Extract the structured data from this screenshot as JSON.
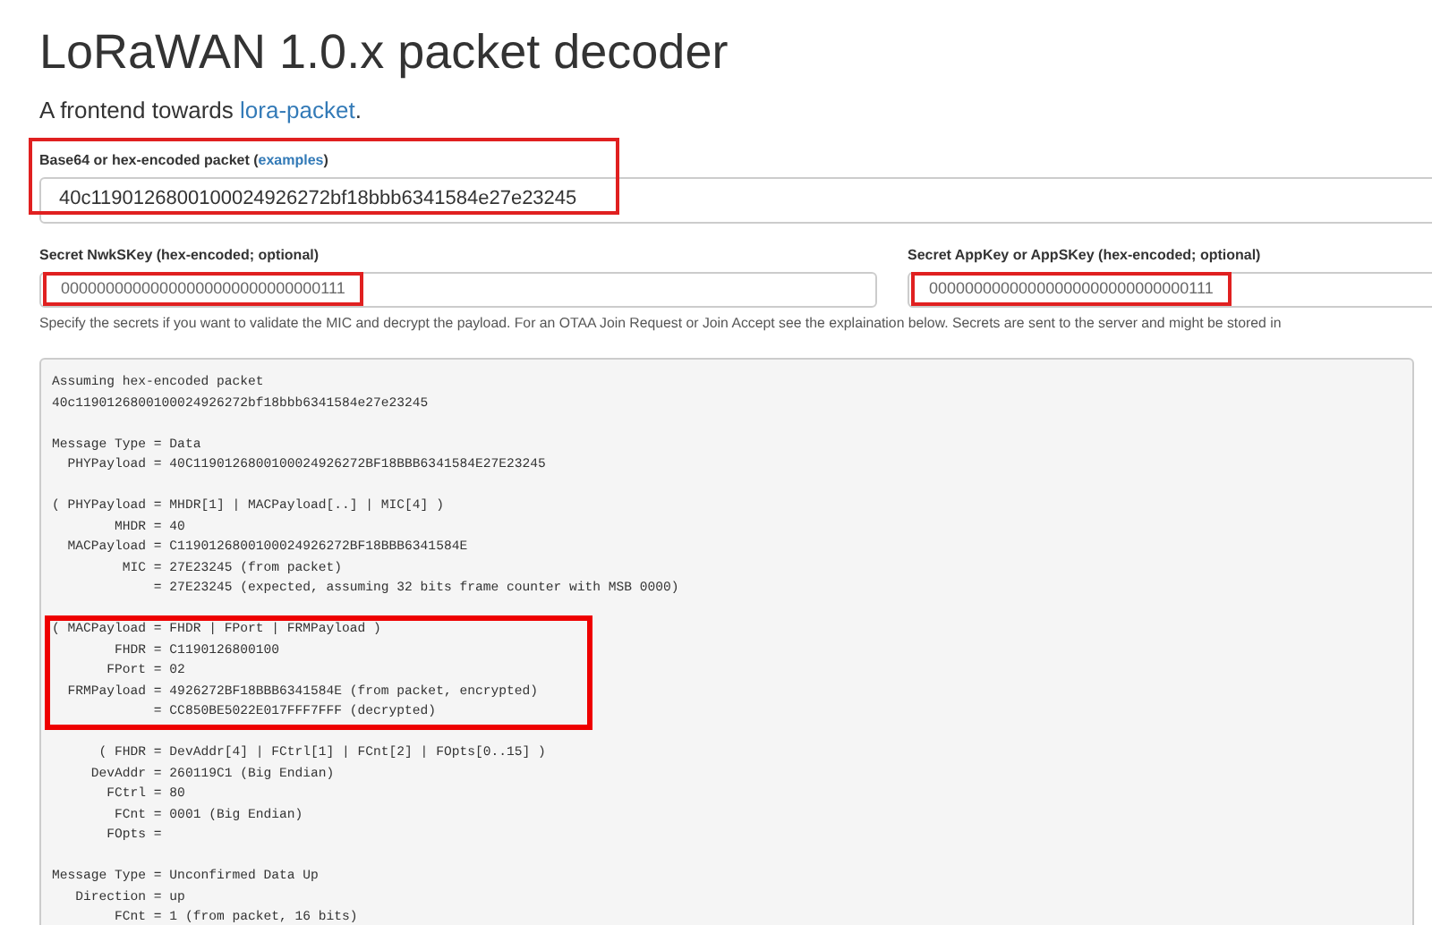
{
  "header": {
    "title": "LoRaWAN 1.0.x packet decoder",
    "subtitle_prefix": "A frontend towards ",
    "subtitle_link": "lora-packet",
    "subtitle_suffix": "."
  },
  "packet": {
    "label": "Base64 or hex-encoded packet (",
    "label_link": "examples",
    "label_suffix": ")",
    "value": "40c1190126800100024926272bf18bbb6341584e27e23245",
    "highlighted": true
  },
  "keys": [
    {
      "label": "Secret NwkSKey (hex-encoded; optional)",
      "value": "00000000000000000000000000000111",
      "highlighted": true
    },
    {
      "label": "Secret AppKey or AppSKey (hex-encoded; optional)",
      "value": "00000000000000000000000000000111",
      "highlighted": true
    }
  ],
  "help_text": "Specify the secrets if you want to validate the MIC and decrypt the payload. For an OTAA Join Request or Join Accept see the explaination below. Secrets are sent to the server and might be stored in",
  "output": [
    {
      "highlighted": false,
      "lines": [
        "Assuming hex-encoded packet",
        "40c1190126800100024926272bf18bbb6341584e27e23245"
      ]
    },
    {
      "highlighted": false,
      "lines": [
        "Message Type = Data",
        "  PHYPayload = 40C1190126800100024926272BF18BBB6341584E27E23245"
      ]
    },
    {
      "highlighted": false,
      "lines": [
        "( PHYPayload = MHDR[1] | MACPayload[..] | MIC[4] )",
        "        MHDR = 40",
        "  MACPayload = C1190126800100024926272BF18BBB6341584E",
        "         MIC = 27E23245 (from packet)",
        "             = 27E23245 (expected, assuming 32 bits frame counter with MSB 0000)"
      ]
    },
    {
      "highlighted": true,
      "lines": [
        "( MACPayload = FHDR | FPort | FRMPayload )",
        "        FHDR = C1190126800100",
        "       FPort = 02",
        "  FRMPayload = 4926272BF18BBB6341584E (from packet, encrypted)",
        "             = CC850BE5022E017FFF7FFF (decrypted)"
      ]
    },
    {
      "highlighted": false,
      "lines": [
        "      ( FHDR = DevAddr[4] | FCtrl[1] | FCnt[2] | FOpts[0..15] )",
        "     DevAddr = 260119C1 (Big Endian)",
        "       FCtrl = 80",
        "        FCnt = 0001 (Big Endian)",
        "       FOpts ="
      ]
    },
    {
      "highlighted": false,
      "lines": [
        "Message Type = Unconfirmed Data Up",
        "   Direction = up",
        "        FCnt = 1 (from packet, 16 bits)"
      ]
    }
  ]
}
